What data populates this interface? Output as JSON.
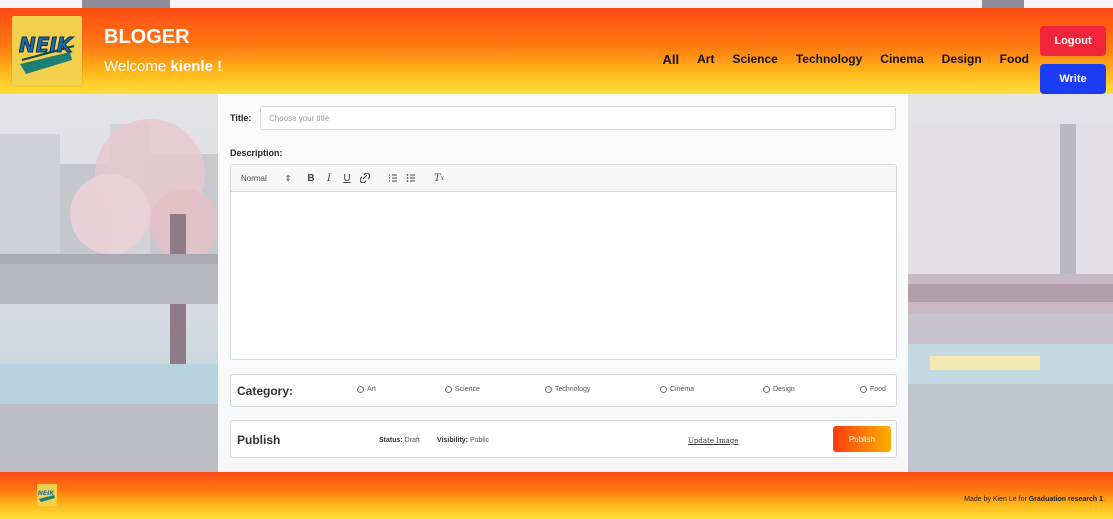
{
  "header": {
    "brand": "BLOGER",
    "welcome_prefix": "Welcome ",
    "username": "kienle !",
    "logo_text": "NEIK",
    "nav": [
      "All",
      "Art",
      "Science",
      "Technology",
      "Cinema",
      "Design",
      "Food"
    ],
    "logout_label": "Logout",
    "write_label": "Write"
  },
  "form": {
    "title_label": "Title:",
    "title_placeholder": "Choose your title",
    "description_label": "Description:",
    "toolbar": {
      "format_label": "Normal",
      "buttons": [
        "B",
        "I",
        "U",
        "link",
        "ordered-list",
        "bullet-list",
        "clear-format"
      ]
    },
    "category_label": "Category:",
    "categories": [
      "Art",
      "Science",
      "Technology",
      "Cinema",
      "Design",
      "Food"
    ],
    "publish_label": "Publish",
    "status_key": "Status:",
    "status_value": "Draft",
    "visibility_key": "Visibility:",
    "visibility_value": "Public",
    "update_image_label": "Update Image",
    "publish_button_label": "Publish"
  },
  "footer": {
    "made_by_prefix": "Made by Kien Le for ",
    "made_by_bold": "Graduation research 1",
    "made_by_suffix": ".",
    "logo_text": "NEIK"
  },
  "colors": {
    "header_gradient_top": "#ff4a14",
    "header_gradient_bottom": "#ffe03a",
    "logout": "#f2243c",
    "write": "#1a3cf4",
    "logo_bg": "#f3cf4e"
  }
}
